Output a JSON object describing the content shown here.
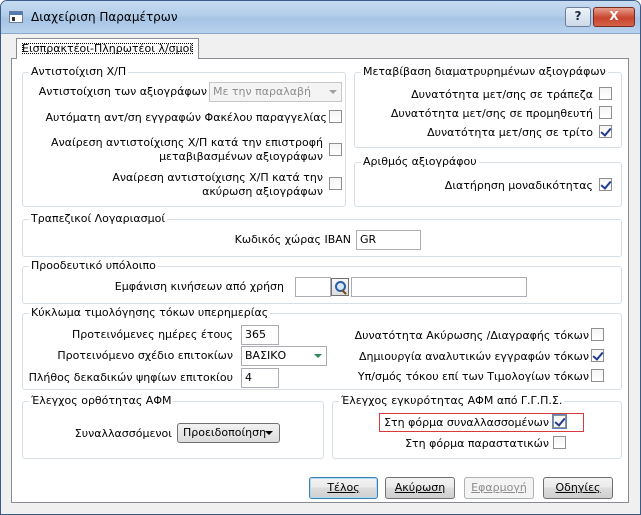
{
  "window": {
    "title": "Διαχείριση Παραμέτρων",
    "help_label": "?",
    "close_label": "X"
  },
  "tab": {
    "label": "Εισπρακτέοι-Πληρωτέοι λ/σμοί"
  },
  "group_xp": {
    "title": "Αντιστοίχιση Χ/Π",
    "rows": [
      {
        "label": "Αντιστοίχιση των αξιογράφων",
        "type": "combo",
        "value": "Με την παραλαβή",
        "disabled": true
      },
      {
        "label": "Αυτόματη αντ/ση εγγραφών Φακέλου παραγγελίας",
        "type": "checkbox",
        "checked": false
      },
      {
        "label": "Αναίρεση αντιστοίχισης Χ/Π κατά την επιστροφή μεταβιβασμένων αξιογράφων",
        "type": "checkbox",
        "checked": false
      },
      {
        "label": "Αναίρεση αντιστοίχισης Χ/Π κατά την ακύρωση αξιογράφων",
        "type": "checkbox",
        "checked": false
      }
    ]
  },
  "group_transfer": {
    "title": "Μεταβίβαση διαματρυρημένων αξιογράφων",
    "rows": [
      {
        "label": "Δυνατότητα μετ/σης σε τράπεζα",
        "checked": false
      },
      {
        "label": "Δυνατότητα μετ/σης σε προμηθευτή",
        "checked": false
      },
      {
        "label": "Δυνατότητα μετ/σης σε τρίτο",
        "checked": true
      }
    ]
  },
  "group_number": {
    "title": "Αριθμός αξιογράφου",
    "rows": [
      {
        "label": "Διατήρηση μοναδικότητας",
        "checked": true
      }
    ]
  },
  "group_bank": {
    "title": "Τραπεζικοί Λογαριασμοί",
    "iban_label": "Κωδικός χώρας IBAN",
    "iban_value": "GR"
  },
  "group_progressive": {
    "title": "Προοδευτικό υπόλοιπο",
    "show_label": "Εμφάνιση κινήσεων από χρήση",
    "code_value": "",
    "desc_value": ""
  },
  "group_interest": {
    "title": "Κύκλωμα τιμολόγησης τόκων υπερημερίας",
    "left": [
      {
        "label": "Προτεινόμενες ημέρες έτους",
        "type": "input",
        "value": "365"
      },
      {
        "label": "Προτεινόμενο σχέδιο επιτοκίων",
        "type": "combo",
        "value": "ΒΑΣΙΚΟ"
      },
      {
        "label": "Πλήθος δεκαδικών ψηφίων επιτοκίου",
        "type": "input",
        "value": "4"
      }
    ],
    "right": [
      {
        "label": "Δυνατότητα Ακύρωσης /Διαγραφής τόκων",
        "checked": false
      },
      {
        "label": "Δημιουργία αναλυτικών εγγραφών τόκων",
        "checked": true
      },
      {
        "label": "Υπ/σμός τόκου επί των Τιμολογίων τόκων",
        "checked": false
      }
    ]
  },
  "group_afm_check": {
    "title": "Έλεγχος ορθότητας ΑΦΜ",
    "label": "Συναλλασσόμενοι",
    "value": "Προειδοποίηση"
  },
  "group_afm_valid": {
    "title": "Έλεγχος εγκυρότητας ΑΦΜ από Γ.Γ.Π.Σ.",
    "rows": [
      {
        "label": "Στη φόρμα συναλλασσομένων",
        "checked": true
      },
      {
        "label": "Στη φόρμα παραστατικών",
        "checked": false
      }
    ]
  },
  "buttons": {
    "ok": "Τέλος",
    "cancel": "Ακύρωση",
    "apply": "Εφαρμογή",
    "help": "Οδηγίες"
  }
}
